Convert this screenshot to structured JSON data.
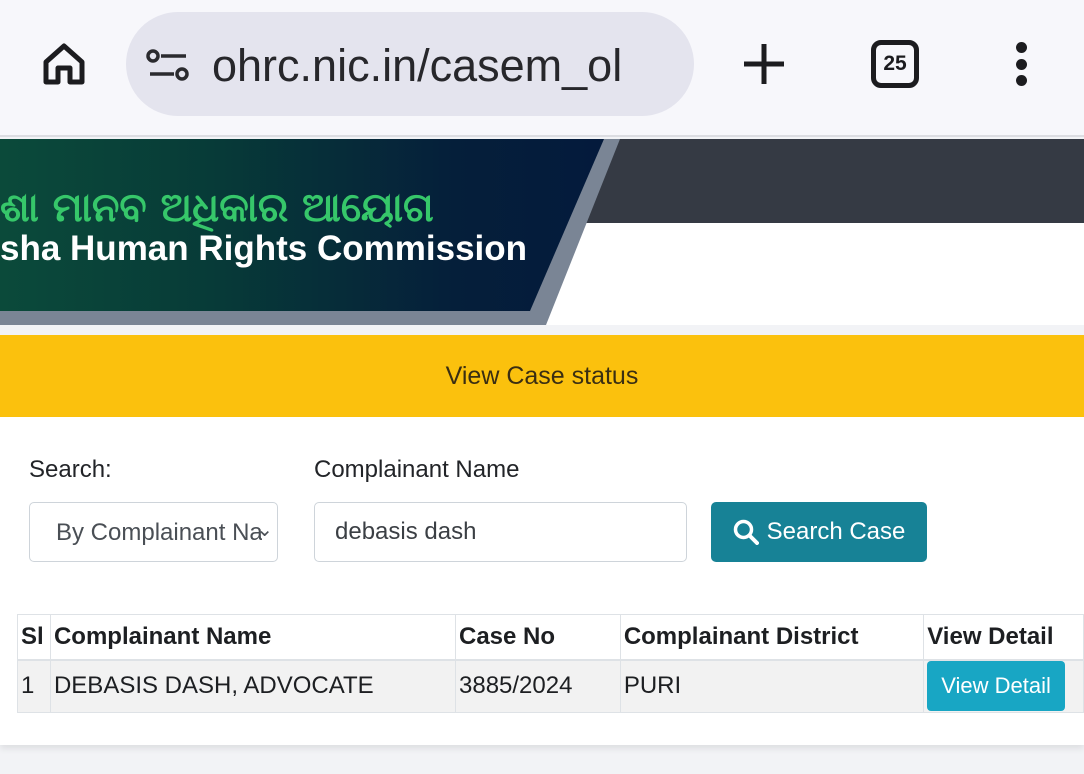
{
  "browser": {
    "url": "ohrc.nic.in/casem_ol",
    "tab_count": "25"
  },
  "header": {
    "odia_title": "ଶା ମାନବ ଅଧିକାର ଆୟୋଗ",
    "english_title": "sha Human Rights Commission"
  },
  "status_bar": {
    "title": "View Case status"
  },
  "form": {
    "search_label": "Search:",
    "search_by_value": "By Complainant Name",
    "name_label": "Complainant Name",
    "name_value": "debasis dash",
    "search_button_label": "Search Case"
  },
  "table": {
    "headers": [
      "Sl",
      "Complainant Name",
      "Case No",
      "Complainant District",
      "View Detail"
    ],
    "rows": [
      {
        "sl": "1",
        "complainant_name": "DEBASIS DASH, ADVOCATE",
        "case_no": "3885/2024",
        "district": "PURI",
        "action_label": "View Detail"
      }
    ]
  }
}
